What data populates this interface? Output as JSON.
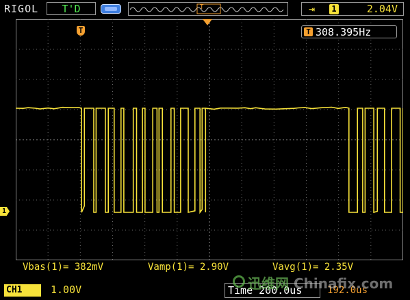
{
  "header": {
    "brand": "RIGOL",
    "status": "T'D",
    "memory_icon": "memory-depth-icon",
    "trigger_edge": "⇥",
    "trigger_channel": "1",
    "trigger_level": "2.04V"
  },
  "frequency": {
    "icon_label": "T",
    "value": "308.395Hz"
  },
  "markers": {
    "trigger_marker": "T",
    "channel_marker": "1"
  },
  "measurements": {
    "vbase": "Vbas(1)= 382mV",
    "vamp": "Vamp(1)= 2.90V",
    "vavg": "Vavg(1)= 2.35V"
  },
  "footer": {
    "ch1_label": "CH1",
    "ch1_scale": "1.00V",
    "timebase": "Time 200.0us",
    "trigger_position": "192.0us"
  },
  "watermark": {
    "cn": "迅维网",
    "en": "Chinafix.com"
  },
  "colors": {
    "trace": "#f7e23a",
    "grid": "#6a6a6a",
    "accent": "#f5a030",
    "background": "#000000"
  },
  "waveform": {
    "high_level_v": 3.28,
    "low_level_v": 0.38,
    "segments": [
      {
        "type": "high",
        "t0": 0.0,
        "t1": 0.17
      },
      {
        "type": "burst",
        "t0": 0.17,
        "t1": 0.49
      },
      {
        "type": "high",
        "t0": 0.49,
        "t1": 0.86
      },
      {
        "type": "burst",
        "t0": 0.86,
        "t1": 1.0
      }
    ]
  }
}
